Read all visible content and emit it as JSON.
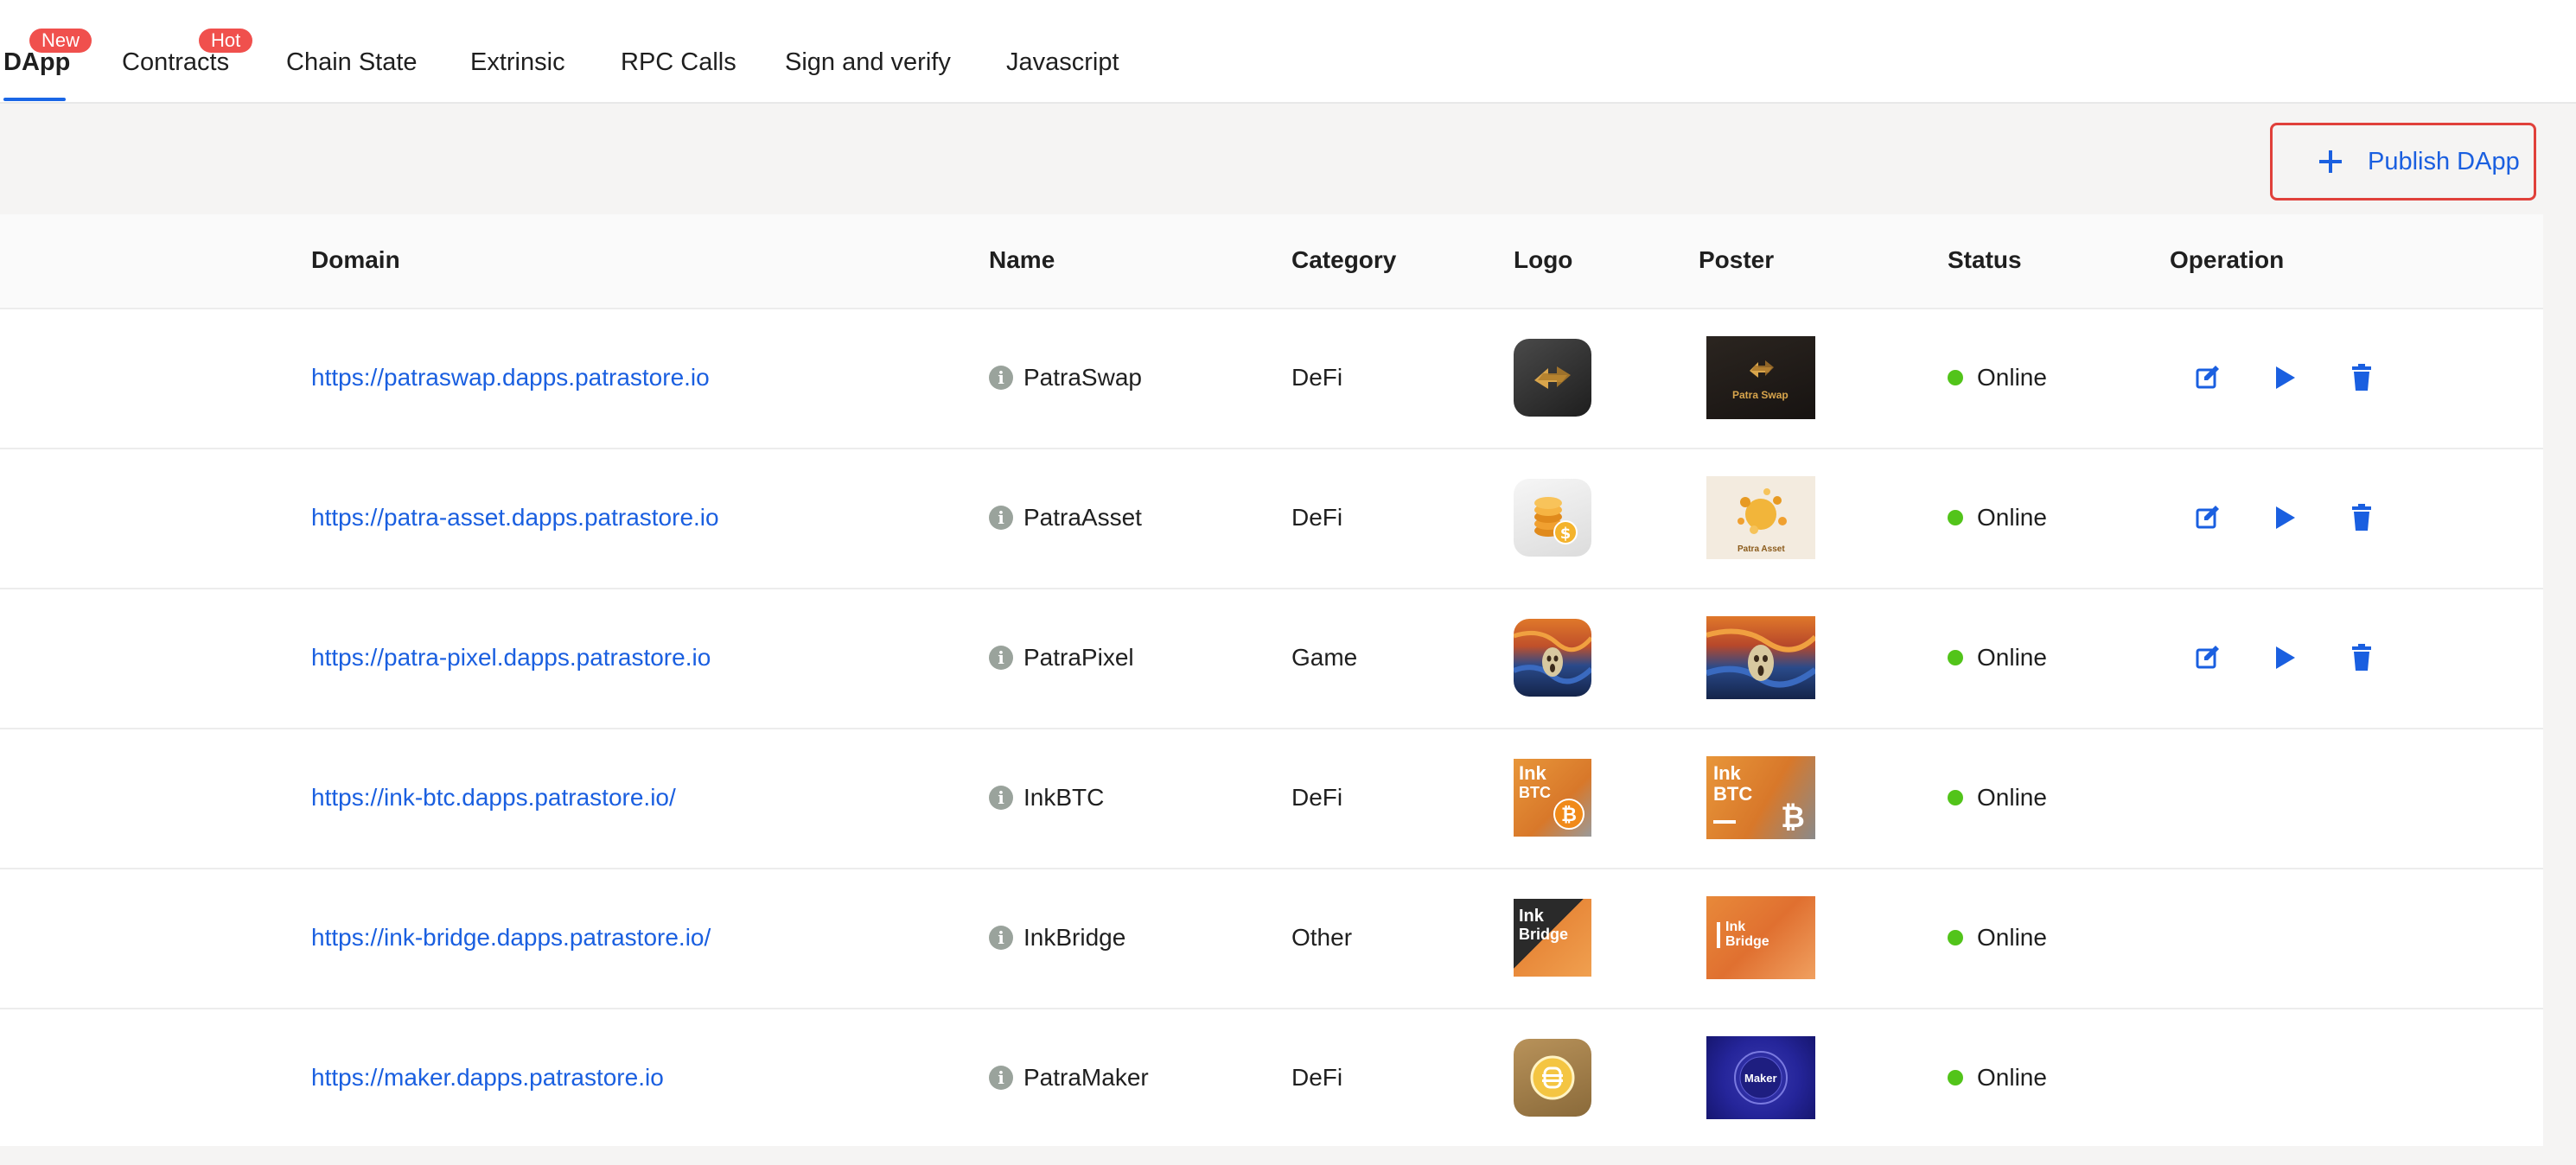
{
  "tabs": [
    {
      "label": "DApp",
      "badge": "New",
      "active": true
    },
    {
      "label": "Contracts",
      "badge": "Hot",
      "active": false
    },
    {
      "label": "Chain State",
      "badge": null,
      "active": false
    },
    {
      "label": "Extrinsic",
      "badge": null,
      "active": false
    },
    {
      "label": "RPC Calls",
      "badge": null,
      "active": false
    },
    {
      "label": "Sign and verify",
      "badge": null,
      "active": false
    },
    {
      "label": "Javascript",
      "badge": null,
      "active": false
    }
  ],
  "toolbar": {
    "publish_label": "Publish DApp",
    "publish_icon": "plus-icon"
  },
  "table": {
    "columns": [
      "Domain",
      "Name",
      "Category",
      "Logo",
      "Poster",
      "Status",
      "Operation"
    ],
    "rows": [
      {
        "domain": "https://patraswap.dapps.patrastore.io",
        "name": "PatraSwap",
        "category": "DeFi",
        "status": "Online",
        "poster_text": "Patra Swap",
        "operations": true
      },
      {
        "domain": "https://patra-asset.dapps.patrastore.io",
        "name": "PatraAsset",
        "category": "DeFi",
        "status": "Online",
        "poster_text": "Patra Asset",
        "operations": true
      },
      {
        "domain": "https://patra-pixel.dapps.patrastore.io",
        "name": "PatraPixel",
        "category": "Game",
        "status": "Online",
        "poster_text": "",
        "operations": true
      },
      {
        "domain": "https://ink-btc.dapps.patrastore.io/",
        "name": "InkBTC",
        "category": "DeFi",
        "status": "Online",
        "logo_text": [
          "Ink",
          "BTC"
        ],
        "poster_text": "Ink BTC",
        "operations": false
      },
      {
        "domain": "https://ink-bridge.dapps.patrastore.io/",
        "name": "InkBridge",
        "category": "Other",
        "status": "Online",
        "logo_text": [
          "Ink",
          "Bridge"
        ],
        "poster_text": "Ink Bridge",
        "operations": false
      },
      {
        "domain": "https://maker.dapps.patrastore.io",
        "name": "PatraMaker",
        "category": "DeFi",
        "status": "Online",
        "poster_text": "Maker",
        "operations": false
      }
    ]
  },
  "colors": {
    "accent": "#1a5fe0",
    "badge": "#f0504d",
    "online": "#52c41a",
    "highlight_border": "#e0403a"
  }
}
